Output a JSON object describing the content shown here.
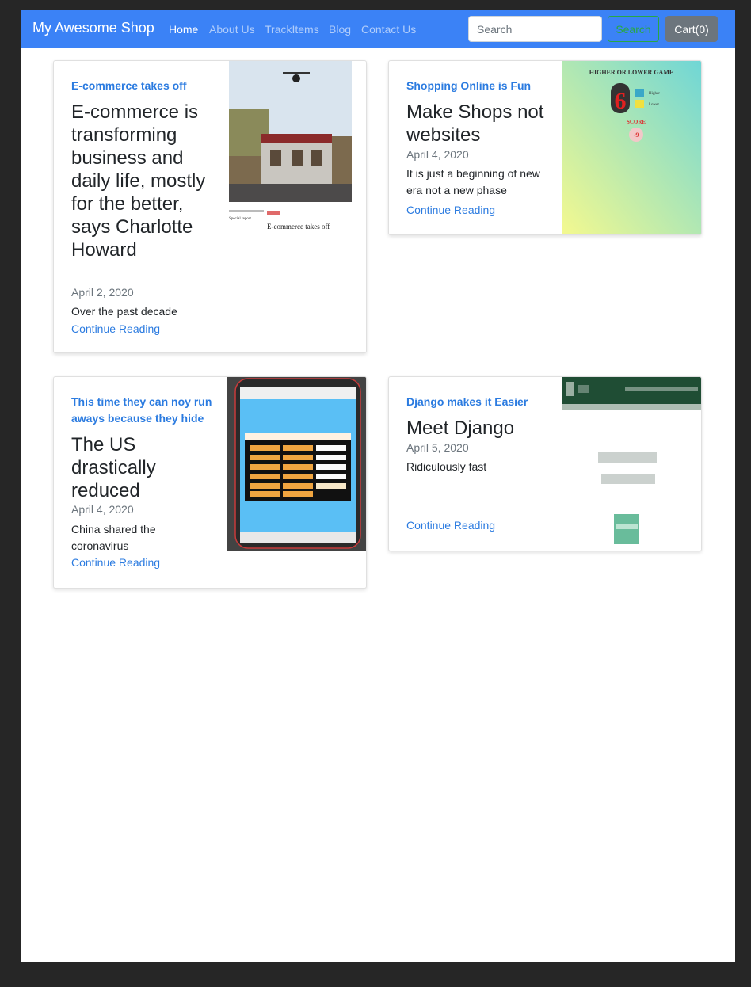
{
  "navbar": {
    "brand": "My Awesome Shop",
    "links": [
      "Home",
      "About Us",
      "TrackItems",
      "Blog",
      "Contact Us"
    ],
    "search_placeholder": "Search",
    "search_button": "Search",
    "cart_label": "Cart(0)"
  },
  "posts": [
    {
      "category": "E-commerce takes off",
      "title": "E-commerce is transforming business and daily life, mostly for the better, says Charlotte Howard",
      "date": "April 2, 2020",
      "excerpt": "Over the past decade",
      "link": "Continue Reading",
      "image_caption": "E-commerce takes off"
    },
    {
      "category": "Shopping Online is Fun",
      "title": "Make Shops not websites",
      "date": "April 4, 2020",
      "excerpt": "It is just a beginning of new era not a new phase",
      "link": "Continue Reading",
      "image_title": "HIGHER OR LOWER GAME",
      "image_digit": "6",
      "image_higher": "Higher",
      "image_lower": "Lower",
      "image_score_label": "SCORE",
      "image_score": "-9"
    },
    {
      "category": "This time they can noy run aways because they hide",
      "title": "The US drastically reduced",
      "date": "April 4, 2020",
      "excerpt": "China shared the coronavirus",
      "link": "Continue Reading"
    },
    {
      "category": "Django makes it Easier",
      "title": "Meet Django",
      "date": "April 5, 2020",
      "excerpt": "Ridiculously fast",
      "link": "Continue Reading"
    }
  ],
  "colors": {
    "navbar": "#3b82f6",
    "link": "#2b7be0",
    "search_button": "#28a745",
    "cart_button": "#6c757d",
    "backdrop": "#262626"
  }
}
